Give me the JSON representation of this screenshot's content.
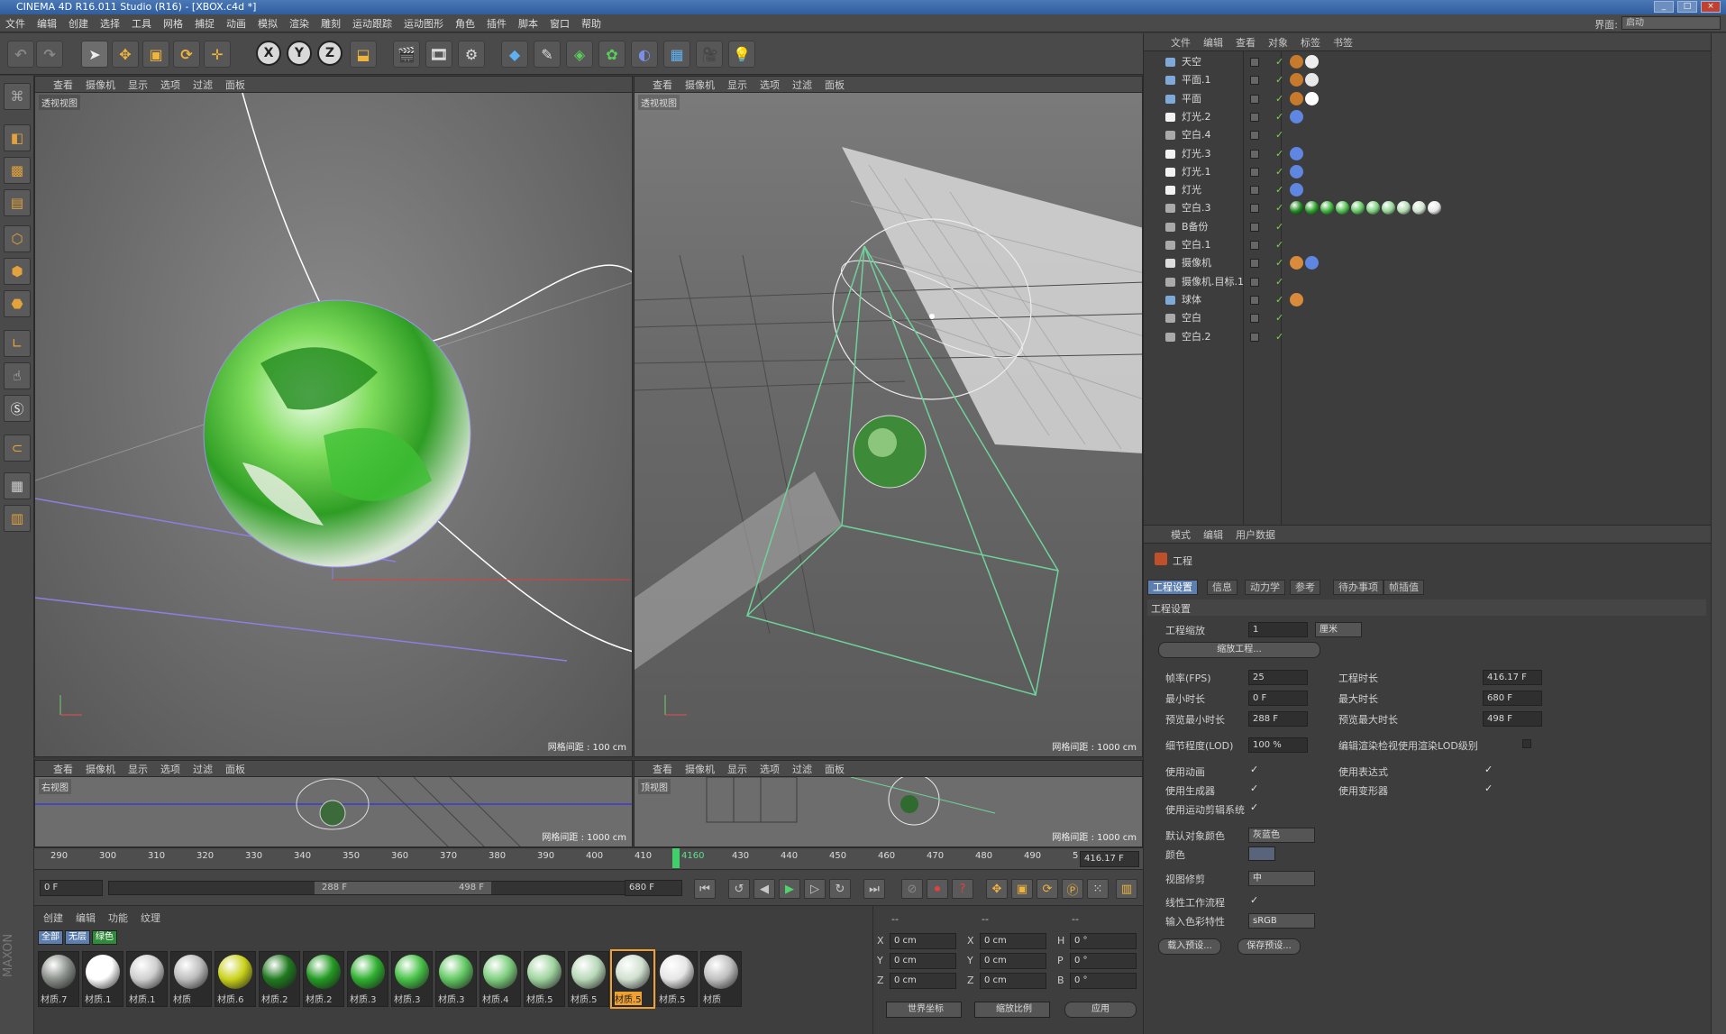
{
  "window": {
    "title": "CINEMA 4D R16.011 Studio (R16) - [XBOX.c4d *]"
  },
  "menubar": {
    "items": [
      "文件",
      "编辑",
      "创建",
      "选择",
      "工具",
      "网格",
      "捕捉",
      "动画",
      "模拟",
      "渲染",
      "雕刻",
      "运动跟踪",
      "运动图形",
      "角色",
      "插件",
      "脚本",
      "窗口",
      "帮助"
    ],
    "layout_label": "界面:",
    "layout_value": "启动"
  },
  "toolbar": {
    "axis_x": "X",
    "axis_y": "Y",
    "axis_z": "Z"
  },
  "viewports": [
    {
      "id": "perspective-left",
      "menu": [
        "查看",
        "摄像机",
        "显示",
        "选项",
        "过滤",
        "面板"
      ],
      "label": "透视视图",
      "grid": "网格间距 : 100 cm"
    },
    {
      "id": "perspective-right",
      "menu": [
        "查看",
        "摄像机",
        "显示",
        "选项",
        "过滤",
        "面板"
      ],
      "label": "透视视图",
      "grid": "网格间距 : 1000 cm"
    },
    {
      "id": "right-view",
      "menu": [
        "查看",
        "摄像机",
        "显示",
        "选项",
        "过滤",
        "面板"
      ],
      "label": "右视图",
      "grid": "网格间距 : 1000 cm"
    },
    {
      "id": "top-view",
      "menu": [
        "查看",
        "摄像机",
        "显示",
        "选项",
        "过滤",
        "面板"
      ],
      "label": "顶视图",
      "grid": "网格间距 : 1000 cm"
    }
  ],
  "timeline": {
    "ticks": [
      "290",
      "300",
      "310",
      "320",
      "330",
      "340",
      "350",
      "360",
      "370",
      "380",
      "390",
      "400",
      "410",
      "4160",
      "430",
      "440",
      "450",
      "460",
      "470",
      "480",
      "490",
      "5"
    ],
    "current_end": "416.17 F",
    "start_field": "0 F",
    "range_start": "288 F",
    "range_end": "498 F",
    "end_field": "680 F"
  },
  "material_manager": {
    "menu": [
      "创建",
      "编辑",
      "功能",
      "纹理"
    ],
    "filters": [
      "全部",
      "无层",
      "绿色"
    ],
    "materials": [
      {
        "label": "材质.7",
        "color": "#8a8f8a"
      },
      {
        "label": "材质.1",
        "color": "#ffffff"
      },
      {
        "label": "材质.1",
        "color": "#cfcfcf"
      },
      {
        "label": "材质",
        "color": "#bdbdbd"
      },
      {
        "label": "材质.6",
        "color": "#c9d21a"
      },
      {
        "label": "材质.2",
        "color": "#1f7a1f"
      },
      {
        "label": "材质.2",
        "color": "#239a23"
      },
      {
        "label": "材质.3",
        "color": "#2fb02f"
      },
      {
        "label": "材质.3",
        "color": "#47c247"
      },
      {
        "label": "材质.3",
        "color": "#62c862"
      },
      {
        "label": "材质.4",
        "color": "#7fcf7f"
      },
      {
        "label": "材质.5",
        "color": "#9fd49f"
      },
      {
        "label": "材质.5",
        "color": "#b8d8b8"
      },
      {
        "label": "材质.5",
        "color": "#d0e0d0"
      },
      {
        "label": "材质.5",
        "color": "#e6e6e6"
      },
      {
        "label": "材质",
        "color": "#c0c0c0"
      }
    ],
    "highlighted_index": 13
  },
  "coords": {
    "header": [
      "--",
      "--",
      "--"
    ],
    "rows": [
      {
        "a": "X",
        "av": "0 cm",
        "b": "X",
        "bv": "0 cm",
        "c": "H",
        "cv": "0 °"
      },
      {
        "a": "Y",
        "av": "0 cm",
        "b": "Y",
        "bv": "0 cm",
        "c": "P",
        "cv": "0 °"
      },
      {
        "a": "Z",
        "av": "0 cm",
        "b": "Z",
        "bv": "0 cm",
        "c": "B",
        "cv": "0 °"
      }
    ],
    "mode1": "世界坐标",
    "mode2": "缩放比例",
    "apply": "应用"
  },
  "object_manager": {
    "menu": [
      "文件",
      "编辑",
      "查看",
      "对象",
      "标签",
      "书签"
    ],
    "objects": [
      {
        "name": "天空",
        "icon_color": "#7fa9d8"
      },
      {
        "name": "平面.1",
        "icon_color": "#7fa9d8"
      },
      {
        "name": "平面",
        "icon_color": "#7fa9d8"
      },
      {
        "name": "灯光.2",
        "icon_color": "#f2f2f2"
      },
      {
        "name": "空白.4",
        "icon_color": "#aaaaaa"
      },
      {
        "name": "灯光.3",
        "icon_color": "#f2f2f2"
      },
      {
        "name": "灯光.1",
        "icon_color": "#f2f2f2"
      },
      {
        "name": "灯光",
        "icon_color": "#f2f2f2"
      },
      {
        "name": "空白.3",
        "icon_color": "#aaaaaa"
      },
      {
        "name": "B备份",
        "icon_color": "#aaaaaa"
      },
      {
        "name": "空白.1",
        "icon_color": "#aaaaaa"
      },
      {
        "name": "摄像机",
        "icon_color": "#dddddd"
      },
      {
        "name": "摄像机.目标.1",
        "icon_color": "#aaaaaa"
      },
      {
        "name": "球体",
        "icon_color": "#7fa9d8"
      },
      {
        "name": "空白",
        "icon_color": "#aaaaaa"
      },
      {
        "name": "空白.2",
        "icon_color": "#aaaaaa"
      }
    ]
  },
  "attribute_manager": {
    "menu": [
      "模式",
      "编辑",
      "用户数据"
    ],
    "object_title": "工程",
    "tabs": [
      "工程设置",
      "信息",
      "动力学",
      "参考",
      "待办事项",
      "帧插值"
    ],
    "section": "工程设置",
    "scale_label": "工程缩放",
    "scale_value": "1",
    "scale_unit": "厘米",
    "scale_button": "缩放工程...",
    "fps_label": "帧率(FPS)",
    "fps_value": "25",
    "duration_label": "工程时长",
    "duration_value": "416.17 F",
    "min_label": "最小时长",
    "min_value": "0 F",
    "max_label": "最大时长",
    "max_value": "680 F",
    "pmin_label": "预览最小时长",
    "pmin_value": "288 F",
    "pmax_label": "预览最大时长",
    "pmax_value": "498 F",
    "lod_label": "细节程度(LOD)",
    "lod_value": "100 %",
    "lod_render_label": "编辑渲染检视使用渲染LOD级别",
    "use_anim": "使用动画",
    "use_expr": "使用表达式",
    "use_gen": "使用生成器",
    "use_deform": "使用变形器",
    "use_mograph": "使用运动剪辑系统",
    "default_color_label": "默认对象颜色",
    "default_color_value": "灰蓝色",
    "color_label": "颜色",
    "view_clip_label": "视图修剪",
    "view_clip_value": "中",
    "linear_label": "线性工作流程",
    "input_profile_label": "输入色彩特性",
    "input_profile_value": "sRGB",
    "load_preset": "载入预设...",
    "save_preset": "保存预设..."
  }
}
